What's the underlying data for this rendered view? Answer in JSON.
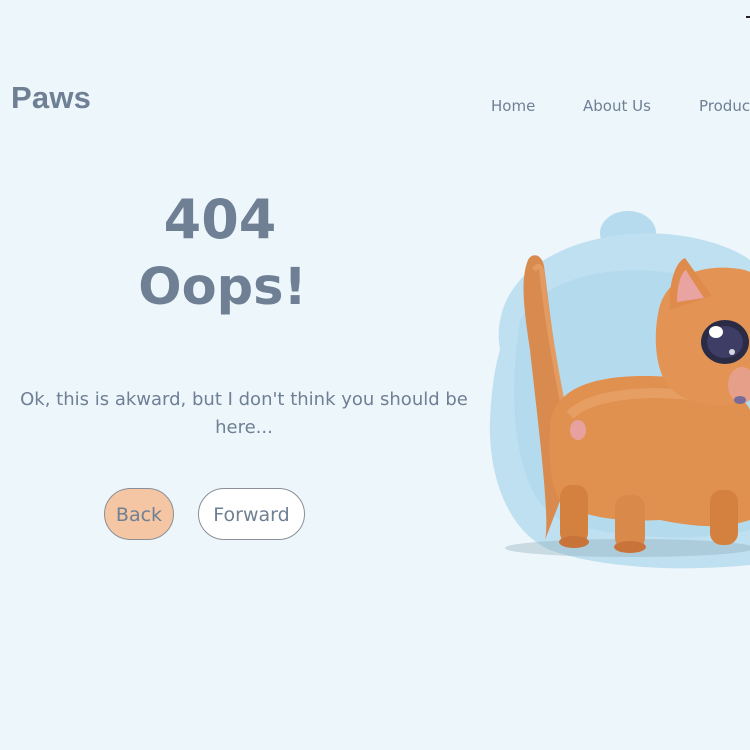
{
  "header": {
    "brand": "Paws",
    "nav": [
      {
        "label": "Home"
      },
      {
        "label": "About Us"
      },
      {
        "label": "Products"
      }
    ]
  },
  "error": {
    "code": "404",
    "heading": "Oops!",
    "message": "Ok, this is akward, but I don't think you should be here..."
  },
  "actions": {
    "back_label": "Back",
    "forward_label": "Forward"
  },
  "colors": {
    "background": "#ecf6fb",
    "text": "#6f7f94",
    "back_button": "#f5c6a4",
    "forward_button": "#ffffff",
    "blob": "#bfe0f0"
  },
  "illustration": {
    "icon": "cat-icon"
  }
}
